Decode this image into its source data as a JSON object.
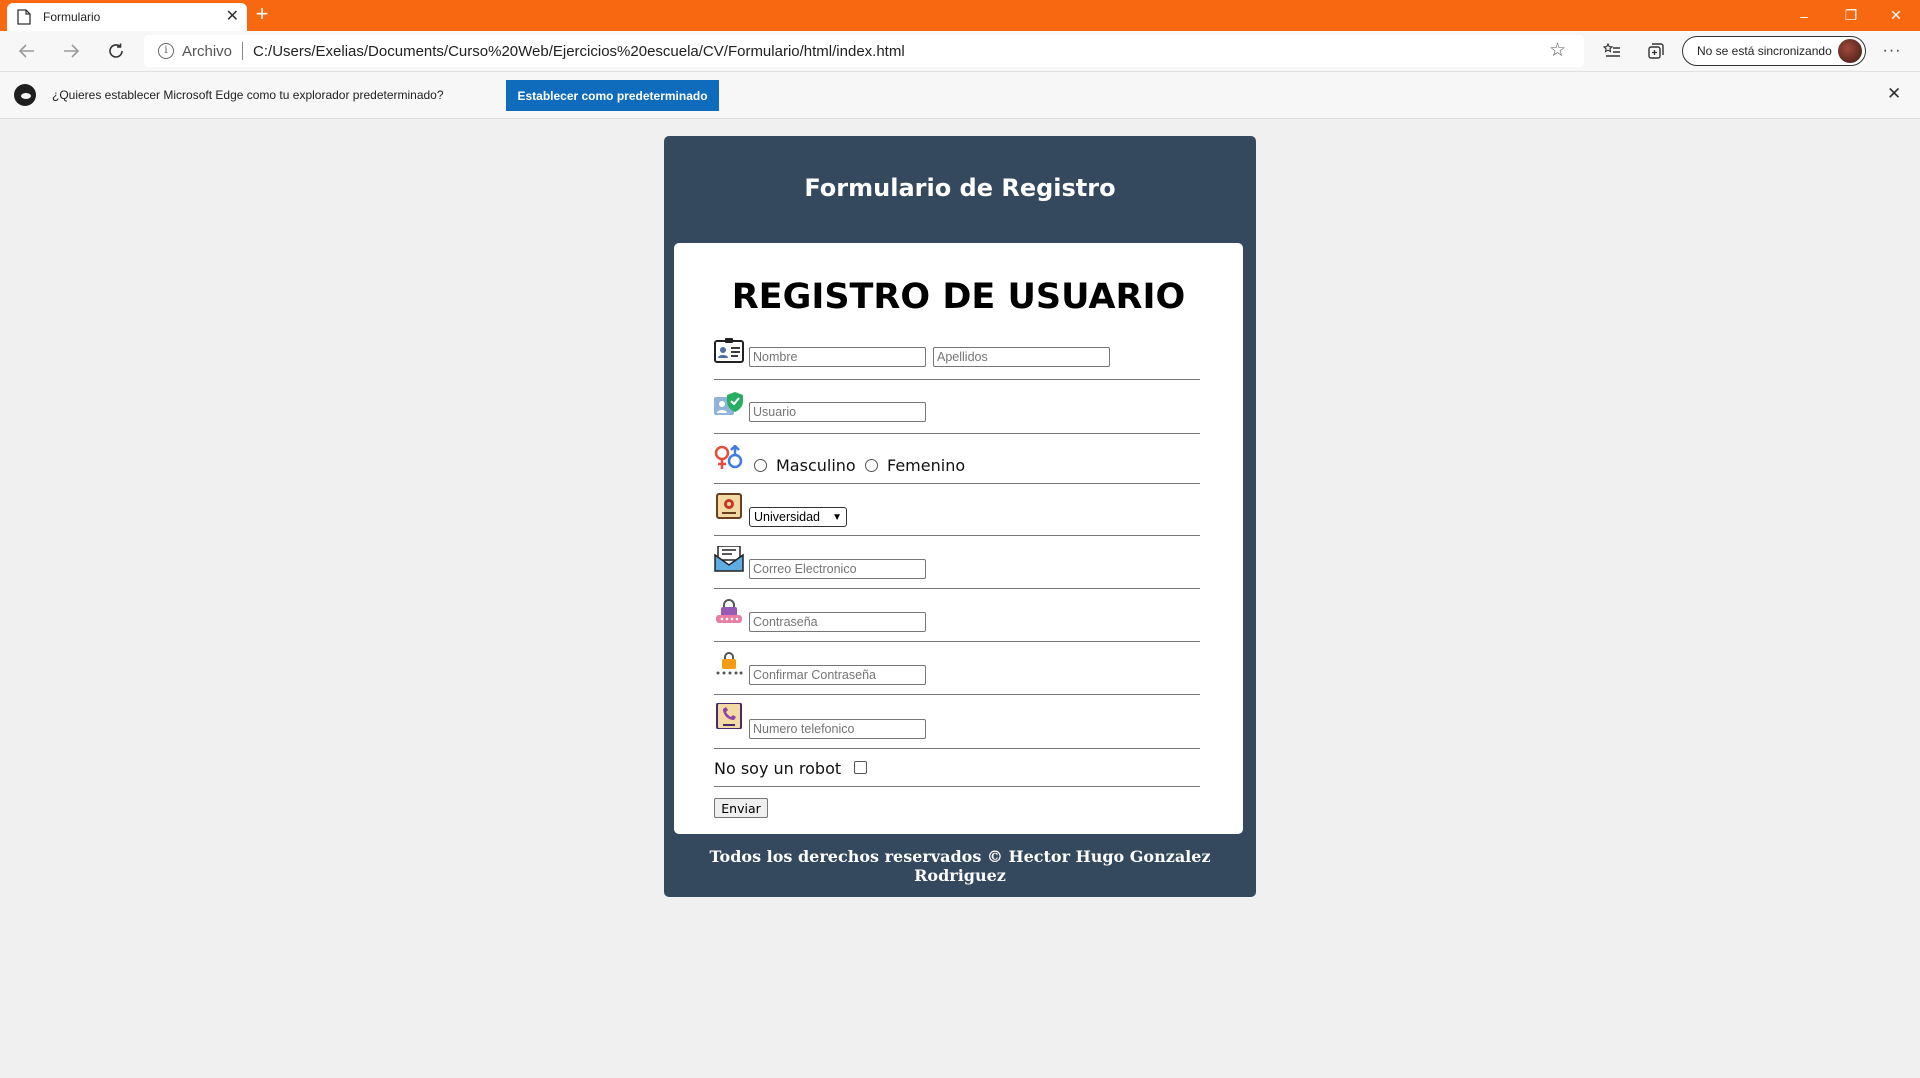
{
  "browser": {
    "tab_title": "Formulario",
    "tab_close": "✕",
    "new_tab": "+",
    "window_controls": [
      "–",
      "❐",
      "✕"
    ],
    "address_scheme": "Archivo",
    "address_url": "C:/Users/Exelias/Documents/Curso%20Web/Ejercicios%20escuela/CV/Formulario/html/index.html",
    "sync_label": "No se está sincronizando",
    "more_label": "···",
    "infobar_text": "¿Quieres establecer Microsoft Edge como tu explorador predeterminado?",
    "infobar_button": "Establecer como predeterminado",
    "infobar_close": "✕",
    "colors": {
      "titlebar": "#f76811",
      "infobar_button": "#0f6cbd"
    },
    "icons": [
      "back-icon",
      "forward-icon",
      "refresh-icon",
      "info-icon",
      "star-icon",
      "favorites-icon",
      "collections-icon",
      "profile-avatar",
      "more-icon"
    ]
  },
  "page": {
    "header_title": "Formulario de Registro",
    "card_title": "REGISTRO DE USUARIO",
    "fields": {
      "nombre_placeholder": "Nombre",
      "apellidos_placeholder": "Apellidos",
      "usuario_placeholder": "Usuario",
      "masculino_label": "Masculino",
      "femenino_label": "Femenino",
      "universidad_selected": "Universidad",
      "correo_placeholder": "Correo Electronico",
      "contrasena_placeholder": "Contraseña",
      "confirmar_placeholder": "Confirmar Contraseña",
      "telefono_placeholder": "Numero telefonico",
      "robot_label": "No soy un robot"
    },
    "submit_label": "Enviar",
    "footer": "Todos los derechos reservados © Hector Hugo Gonzalez Rodriguez",
    "colors": {
      "container": "#34495e",
      "card": "#ffffff"
    }
  }
}
